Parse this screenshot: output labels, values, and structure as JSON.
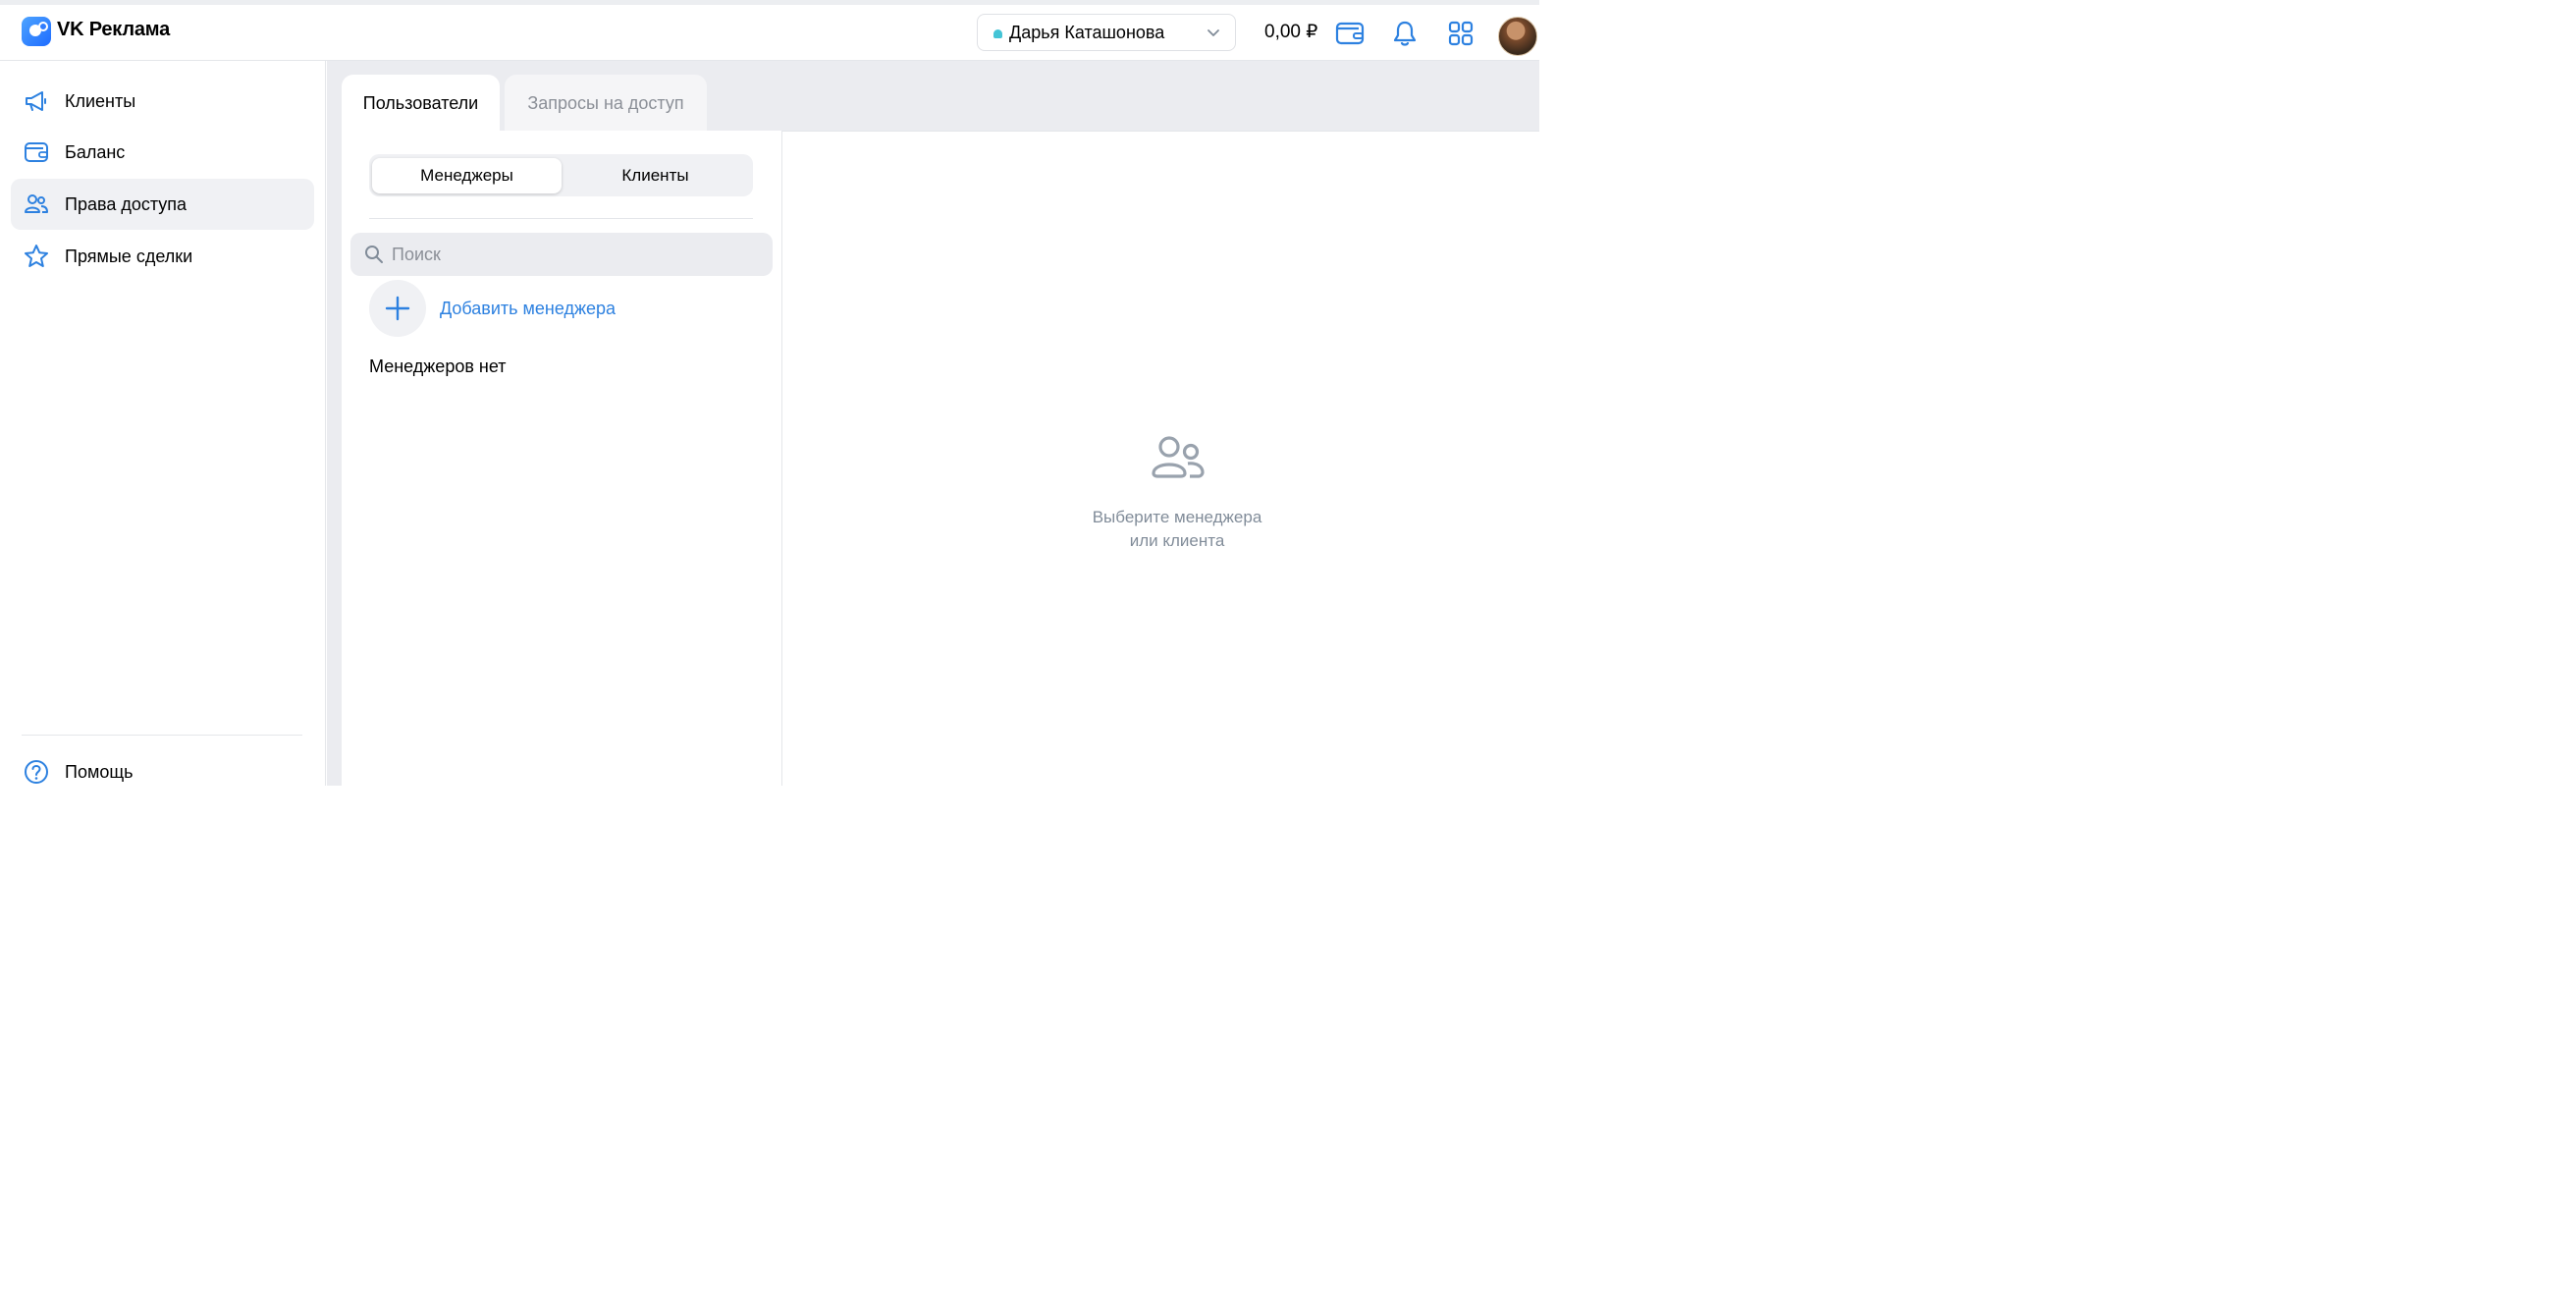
{
  "header": {
    "app_title": "VK Реклама",
    "account_name": "Дарья Каташонова",
    "balance": "0,00 ₽",
    "icons": [
      "wallet-icon",
      "bell-icon",
      "apps-grid-icon"
    ]
  },
  "sidebar": {
    "items": [
      {
        "label": "Клиенты",
        "icon": "megaphone-icon"
      },
      {
        "label": "Баланс",
        "icon": "wallet-icon"
      },
      {
        "label": "Права доступа",
        "icon": "users-icon",
        "active": true
      },
      {
        "label": "Прямые сделки",
        "icon": "star-icon"
      }
    ],
    "help_label": "Помощь"
  },
  "tabs": [
    {
      "label": "Пользователи",
      "active": true
    },
    {
      "label": "Запросы на доступ",
      "active": false
    }
  ],
  "segment": {
    "options": [
      "Менеджеры",
      "Клиенты"
    ],
    "selected": "Менеджеры"
  },
  "search": {
    "placeholder": "Поиск",
    "value": ""
  },
  "add_manager_label": "Добавить менеджера",
  "empty_list_text": "Менеджеров нет",
  "detail_placeholder": {
    "line1": "Выберите менеджера",
    "line2": "или клиента"
  },
  "colors": {
    "accent": "#2d81e0",
    "muted": "#818c99",
    "bg": "#ebecf0"
  }
}
